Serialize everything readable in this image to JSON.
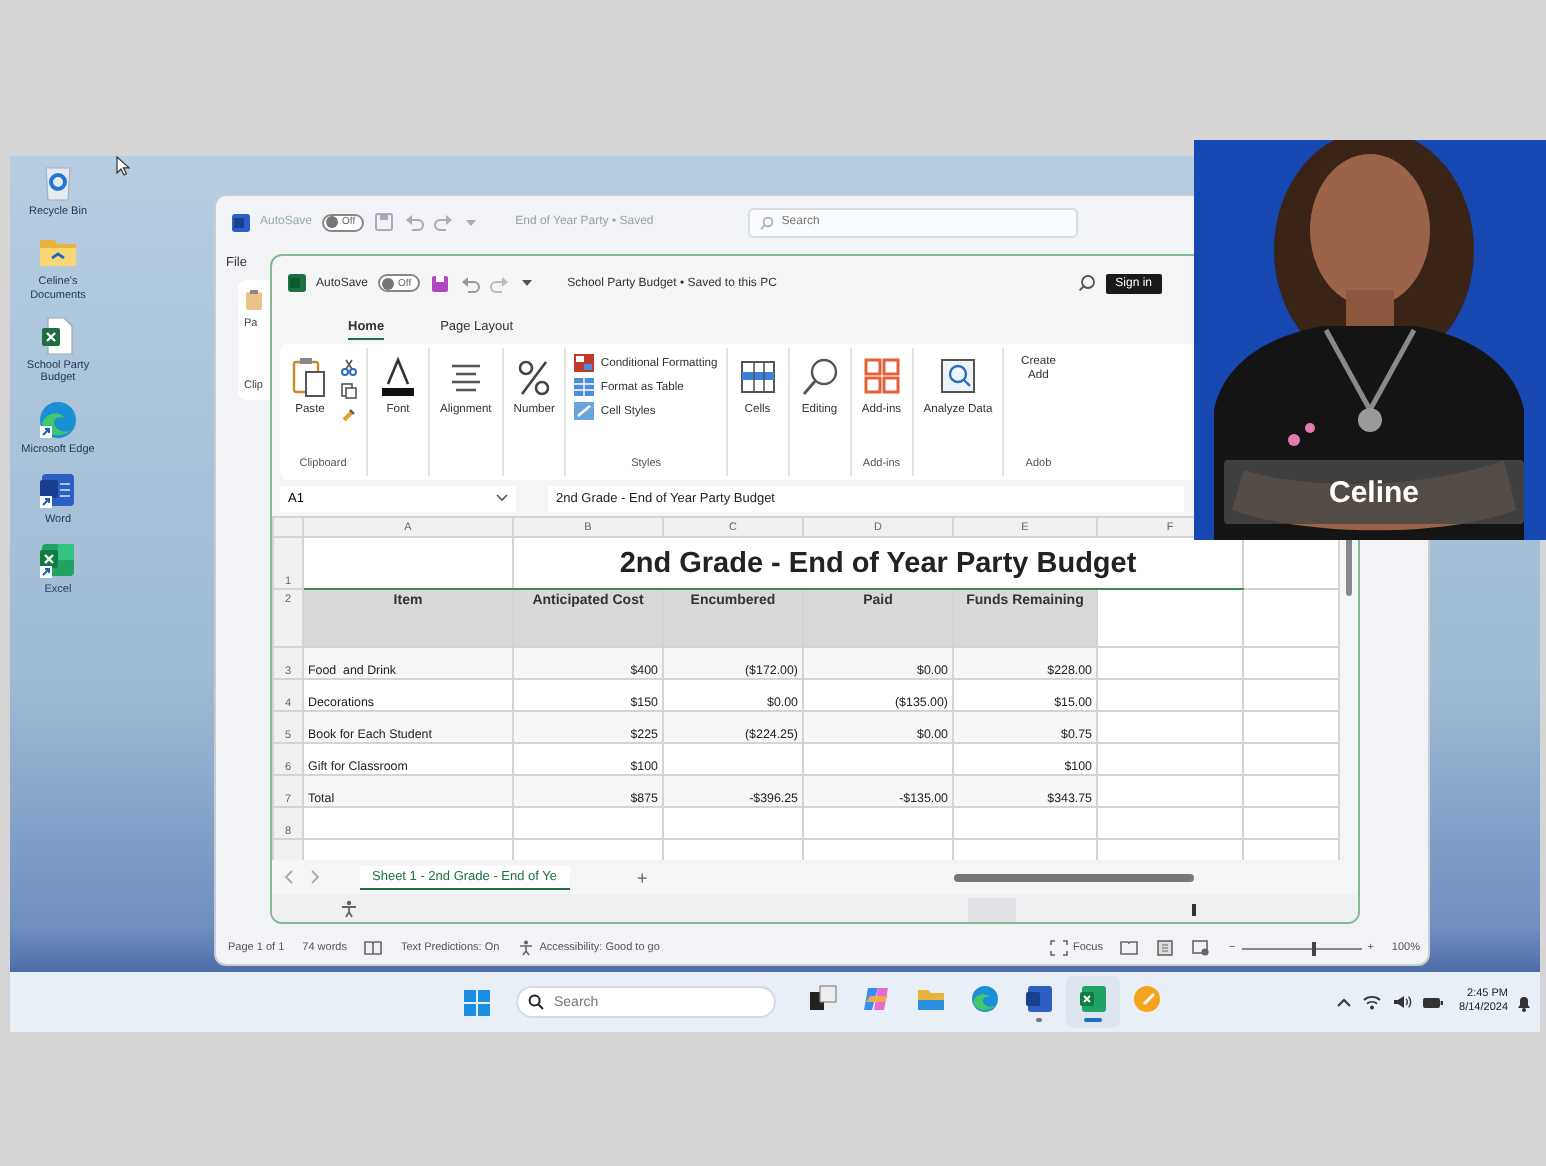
{
  "desktop_icons": [
    {
      "kind": "recycle",
      "label": "Recycle Bin"
    },
    {
      "kind": "folder",
      "label": "Celine's Documents"
    },
    {
      "kind": "excel_file",
      "label": "School Party Budget"
    },
    {
      "kind": "edge",
      "label": "Microsoft Edge"
    },
    {
      "kind": "word",
      "label": "Word"
    },
    {
      "kind": "excel",
      "label": "Excel"
    }
  ],
  "word_window": {
    "autosave": {
      "label": "AutoSave",
      "toggle": "Off",
      "on": false
    },
    "title": "End of Year Party • Saved",
    "search": {
      "placeholder": "Search"
    },
    "menu": "File",
    "clipboard_button": "Pa",
    "clipboard_group": "Clip",
    "status_bar": {
      "page": "Page 1 of 1",
      "words": "74 words",
      "predictions": "Text Predictions: On",
      "accessibility": "Accessibility: Good to go",
      "focus": "Focus",
      "zoom_out": "−",
      "zoom_in": "+",
      "zoom": {
        "level": 0.6,
        "reading": "100%"
      }
    }
  },
  "excel_window": {
    "autosave": {
      "label": "AutoSave",
      "toggle": "Off",
      "on": false
    },
    "title": "School Party Budget • Saved to this PC",
    "sign_in": "Sign in",
    "tabs": [
      {
        "label": "Home",
        "selected": true
      },
      {
        "label": "Page Layout",
        "selected": false
      }
    ],
    "ribbon": [
      {
        "label": "Clipboard",
        "items": [
          {
            "kind": "paste",
            "label": "Paste"
          }
        ]
      },
      {
        "items": [
          {
            "kind": "font",
            "label": "Font"
          }
        ]
      },
      {
        "items": [
          {
            "kind": "alignment",
            "label": "Alignment"
          }
        ]
      },
      {
        "items": [
          {
            "kind": "number",
            "label": "Number"
          }
        ]
      },
      {
        "label": "Styles",
        "items": [
          {
            "kind": "conditional",
            "label": "Conditional Formatting"
          },
          {
            "kind": "table",
            "label": "Format as Table"
          },
          {
            "kind": "cellstyles",
            "label": "Cell Styles"
          }
        ]
      },
      {
        "items": [
          {
            "kind": "cells",
            "label": "Cells"
          }
        ]
      },
      {
        "items": [
          {
            "kind": "editing",
            "label": "Editing"
          }
        ]
      },
      {
        "label": "Add-ins",
        "items": [
          {
            "kind": "addins",
            "label": "Add-ins"
          }
        ]
      },
      {
        "items": [
          {
            "kind": "analyze",
            "label": "Analyze Data"
          }
        ]
      },
      {
        "label": "Adob",
        "items": [
          {
            "kind": "create",
            "label": "Create Add"
          }
        ]
      }
    ],
    "name_box": "A1",
    "formula": "2nd Grade - End of Year Party Budget",
    "columns": [
      "A",
      "B",
      "C",
      "D",
      "E",
      "F"
    ],
    "title_row": {
      "number": "1",
      "text": "2nd Grade - End of Year Party Budget"
    },
    "header_row": {
      "number": "2",
      "cells": [
        "Item",
        "Anticipated Cost",
        "Encumbered",
        "Paid",
        "Funds Remaining"
      ]
    },
    "rows": [
      {
        "number": "3",
        "cells": [
          "Food  and Drink",
          "$400",
          "($172.00)",
          "$0.00",
          "$228.00"
        ]
      },
      {
        "number": "4",
        "cells": [
          "Decorations",
          "$150",
          "$0.00",
          "($135.00)",
          "$15.00"
        ]
      },
      {
        "number": "5",
        "cells": [
          "Book for Each Student",
          "$225",
          "($224.25)",
          "$0.00",
          "$0.75"
        ]
      },
      {
        "number": "6",
        "cells": [
          "Gift for Classroom",
          "$100",
          null,
          null,
          "$100"
        ]
      },
      {
        "number": "7",
        "cells": [
          "Total",
          "$875",
          "-$396.25",
          "-$135.00",
          "$343.75"
        ]
      },
      {
        "number": "8",
        "cells": [
          null,
          null,
          null,
          null,
          null
        ]
      }
    ],
    "sheet_tabs": [
      {
        "label": "Sheet 1 - 2nd Grade - End of Ye",
        "selected": true
      }
    ],
    "add_sheet": "+"
  },
  "presenter": {
    "name": "Celine"
  },
  "taskbar": {
    "search": {
      "placeholder": "Search"
    },
    "apps": [
      {
        "kind": "taskview",
        "active": false,
        "running": false
      },
      {
        "kind": "copilot",
        "active": false,
        "running": false
      },
      {
        "kind": "explorer",
        "active": false,
        "running": false
      },
      {
        "kind": "edge",
        "active": false,
        "running": false
      },
      {
        "kind": "word",
        "active": false,
        "running": true
      },
      {
        "kind": "excel",
        "active": true,
        "running": true
      },
      {
        "kind": "other",
        "active": false,
        "running": false
      }
    ],
    "time": "2:45 PM",
    "date": "8/14/2024"
  }
}
